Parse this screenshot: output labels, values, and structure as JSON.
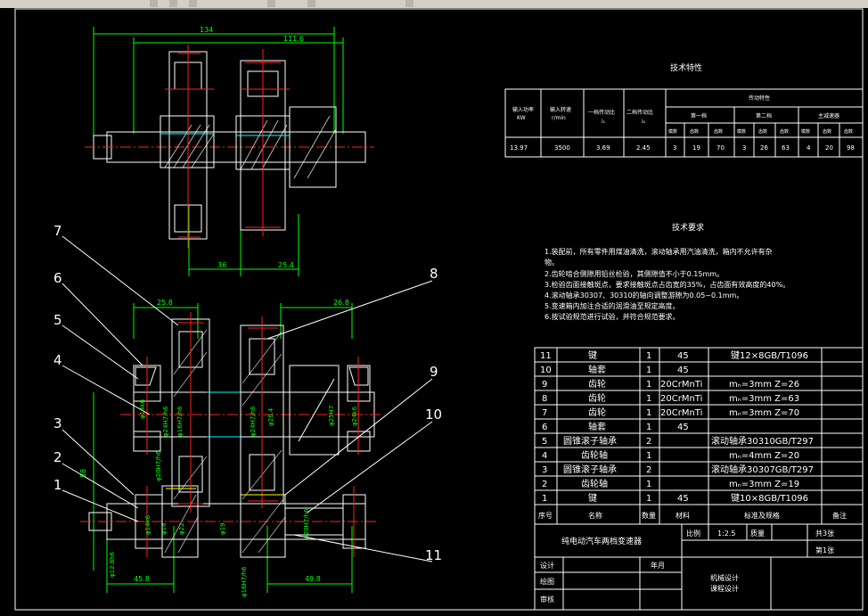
{
  "tech_char": {
    "title": "技术特性",
    "h_power": "输入功率",
    "h_power_unit": "KW",
    "h_speed": "输入转速",
    "h_speed_unit": "r/min",
    "h_ratio1": "一档传动比",
    "h_ratio1_sym": "i₁",
    "h_ratio2": "二档传动比",
    "h_ratio2_sym": "i₂",
    "h_trans": "传动特性",
    "h_g1": "第一档",
    "h_g2": "第二档",
    "h_g3": "主减速器",
    "sub_m": "模数",
    "sub_z": "齿数",
    "values": [
      "13.97",
      "3500",
      "3.69",
      "2.45",
      "3",
      "19",
      "70",
      "3",
      "26",
      "63",
      "4",
      "20",
      "98"
    ]
  },
  "tech_req": {
    "title": "技术要求",
    "lines": [
      "1.装配前，所有零件用煤油清洗，滚动轴承用汽油清洗，箱内不允许有杂",
      "物。",
      "2.齿轮啮合侧隙用铅丝检验，其侧隙值不小于0.15mm。",
      "3.检验齿面接触斑点，要求接触斑点占齿宽的35%，占齿面有效高度的40%。",
      "4.滚动轴承30307、30310的轴向调整游隙为0.05~0.1mm。",
      "5.变速箱内加注合适的润滑油至规定高度。",
      "6.按试验规范进行试验，并符合规范要求。"
    ]
  },
  "bom": {
    "rows": [
      {
        "no": "11",
        "name": "键",
        "qty": "1",
        "mat": "45",
        "std": "键12×8GB/T1096"
      },
      {
        "no": "10",
        "name": "轴套",
        "qty": "1",
        "mat": "45",
        "std": ""
      },
      {
        "no": "9",
        "name": "齿轮",
        "qty": "1",
        "mat": "20CrMnTi",
        "std": "mₙ=3mm  Z=26"
      },
      {
        "no": "8",
        "name": "齿轮",
        "qty": "1",
        "mat": "20CrMnTi",
        "std": "mₙ=3mm  Z=63"
      },
      {
        "no": "7",
        "name": "齿轮",
        "qty": "1",
        "mat": "20CrMnTi",
        "std": "mₙ=3mm  Z=70"
      },
      {
        "no": "6",
        "name": "轴套",
        "qty": "1",
        "mat": "45",
        "std": ""
      },
      {
        "no": "5",
        "name": "圆锥滚子轴承",
        "qty": "2",
        "mat": "",
        "std": "滚动轴承30310GB/T297"
      },
      {
        "no": "4",
        "name": "齿轮轴",
        "qty": "1",
        "mat": "",
        "std": "mₙ=4mm  Z=20"
      },
      {
        "no": "3",
        "name": "圆锥滚子轴承",
        "qty": "2",
        "mat": "",
        "std": "滚动轴承30307GB/T297"
      },
      {
        "no": "2",
        "name": "齿轮轴",
        "qty": "1",
        "mat": "",
        "std": "mₙ=3mm  Z=19"
      },
      {
        "no": "1",
        "name": "键",
        "qty": "1",
        "mat": "45",
        "std": "键10×8GB/T1096"
      }
    ],
    "header": {
      "no": "序号",
      "name": "名称",
      "qty": "数量",
      "mat": "材料",
      "std": "标准及规格",
      "note": "备注"
    }
  },
  "title_block": {
    "name": "纯电动汽车两档变速器",
    "scale_label": "比例",
    "scale": "1:2.5",
    "mass_label": "质量",
    "sheets_total": "共3张",
    "sheet_no": "第1张",
    "design": "设计",
    "drawing": "绘图",
    "review": "审核",
    "date": "年月",
    "course1": "机械设计",
    "course2": "课程设计"
  },
  "dims": {
    "top": [
      "134",
      "111.6",
      "36",
      "25.4"
    ],
    "mid": [
      "25.8",
      "26.8",
      "58"
    ],
    "bottom": [
      "45.8",
      "49.8"
    ],
    "fits": [
      "φ24H7/h6",
      "φ16H7/h6",
      "φ20H7/h6",
      "φ24H7/h6",
      "φ26.4",
      "φ25H7",
      "φ24k6",
      "φ14k6",
      "φ12.8h6",
      "φ16",
      "φ22",
      "φ19",
      "φ16H7/h6",
      "φ14k6",
      "φ20H7/h6"
    ]
  },
  "balloons": [
    "1",
    "2",
    "3",
    "4",
    "5",
    "6",
    "7",
    "8",
    "9",
    "10",
    "11"
  ],
  "colors": {
    "bg": "#000000",
    "line": "#ffffff",
    "dim": "#00ff00",
    "red": "#ff2020",
    "yellow": "#ffff00",
    "cyan": "#00ffff"
  }
}
